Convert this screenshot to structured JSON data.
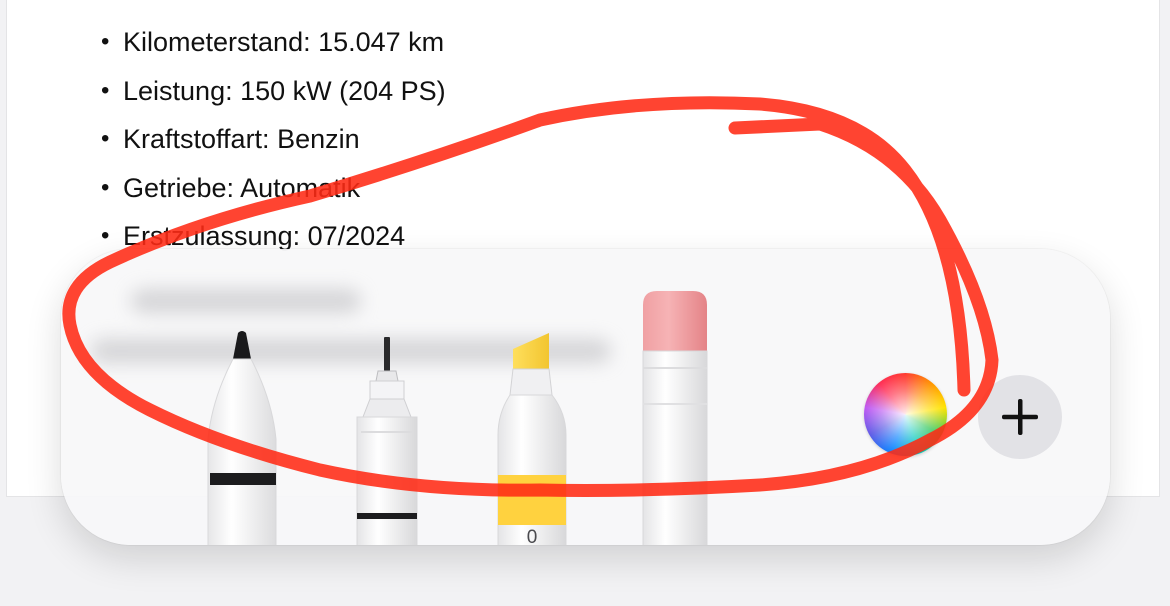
{
  "document": {
    "specs": [
      {
        "bullet": "•",
        "text": "Kilometerstand: 15.047 km"
      },
      {
        "bullet": "•",
        "text": "Leistung: 150 kW (204 PS)"
      },
      {
        "bullet": "•",
        "text": "Kraftstoffart: Benzin"
      },
      {
        "bullet": "•",
        "text": "Getriebe: Automatik"
      },
      {
        "bullet": "•",
        "text": "Erstzulassung: 07/2024"
      }
    ]
  },
  "toolbar": {
    "tools": [
      {
        "name": "pen",
        "icon": "pen-icon",
        "band_color": "#1c1c1e"
      },
      {
        "name": "fineliner",
        "icon": "fineliner-icon",
        "band_color": "#1c1c1e"
      },
      {
        "name": "highlighter",
        "icon": "highlighter-icon",
        "band_color": "#ffd23f",
        "width_label": "0"
      },
      {
        "name": "eraser",
        "icon": "eraser-icon",
        "band_color": "#ef8f92"
      }
    ],
    "color_picker_icon": "color-wheel-icon",
    "add_button_icon": "plus-icon"
  },
  "annotation": {
    "type": "freehand-loop",
    "color": "#ff2a14"
  }
}
